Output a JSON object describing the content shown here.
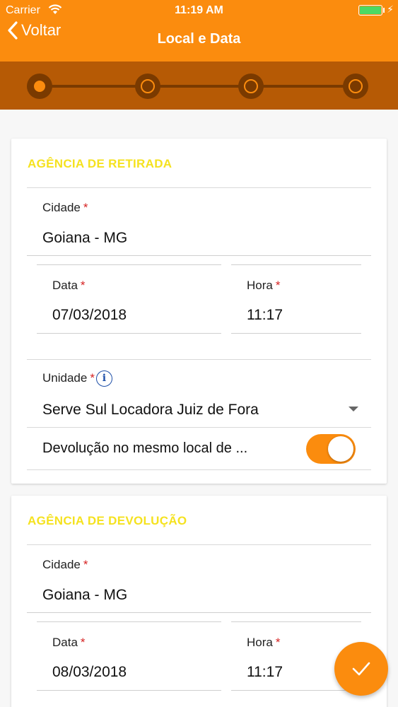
{
  "status_bar": {
    "carrier": "Carrier",
    "time": "11:19 AM"
  },
  "nav": {
    "back_label": "Voltar",
    "title": "Local e Data"
  },
  "stepper": {
    "steps": 4,
    "active": 1
  },
  "pickup": {
    "section_title": "AGÊNCIA DE RETIRADA",
    "city_label": "Cidade",
    "city_value": "Goiana - MG",
    "date_label": "Data",
    "date_value": "07/03/2018",
    "time_label": "Hora",
    "time_value": "11:17",
    "unit_label": "Unidade",
    "unit_value": "Serve Sul Locadora Juiz de Fora",
    "same_place_label": "Devolução no mesmo local de ...",
    "same_place_on": true
  },
  "return": {
    "section_title": "AGÊNCIA DE DEVOLUÇÃO",
    "city_label": "Cidade",
    "city_value": "Goiana - MG",
    "date_label": "Data",
    "date_value": "08/03/2018",
    "time_label": "Hora",
    "time_value": "11:17"
  },
  "required_mark": "*",
  "colors": {
    "primary": "#fb8c0e",
    "stepper_bg": "#b65a05",
    "section_title": "#f5e21f",
    "required": "#d62323"
  }
}
